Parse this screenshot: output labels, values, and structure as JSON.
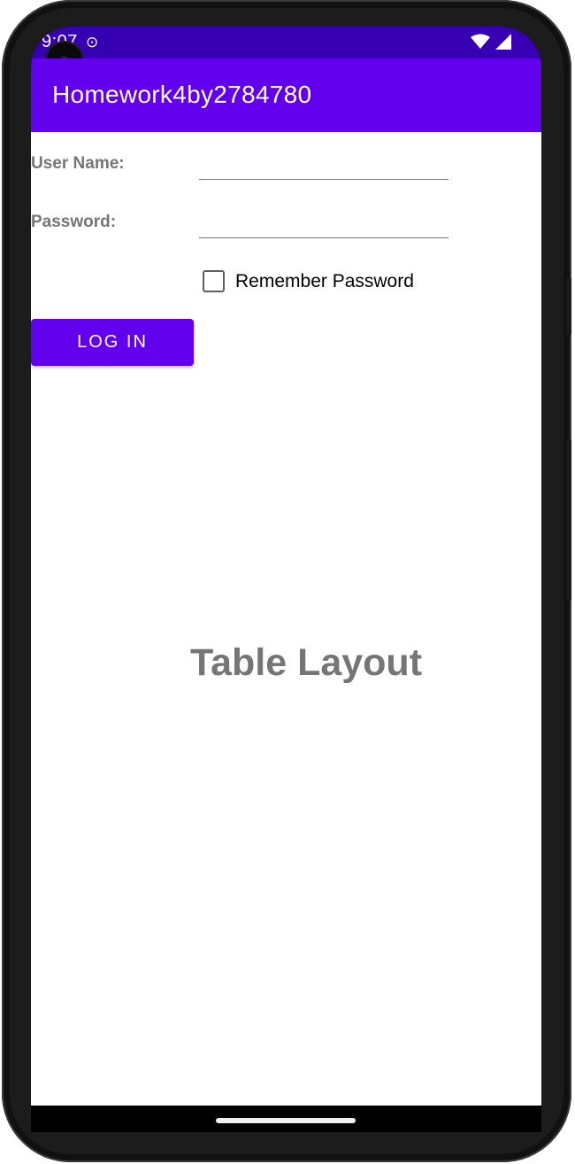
{
  "status_bar": {
    "time": "9:07",
    "notification_icon": "sync-icon",
    "wifi_icon": "wifi-icon",
    "signal_icon": "cell-signal-icon"
  },
  "app_bar": {
    "title": "Homework4by2784780",
    "color": "#6200ee"
  },
  "form": {
    "username_label": "User Name:",
    "username_value": "",
    "password_label": "Password:",
    "password_value": "",
    "remember_label": "Remember Password",
    "remember_checked": false,
    "login_label": "LOG IN"
  },
  "main": {
    "title": "Table Layout"
  },
  "colors": {
    "status_bar": "#3700b3",
    "primary": "#6200ee",
    "label_gray": "#757575"
  }
}
